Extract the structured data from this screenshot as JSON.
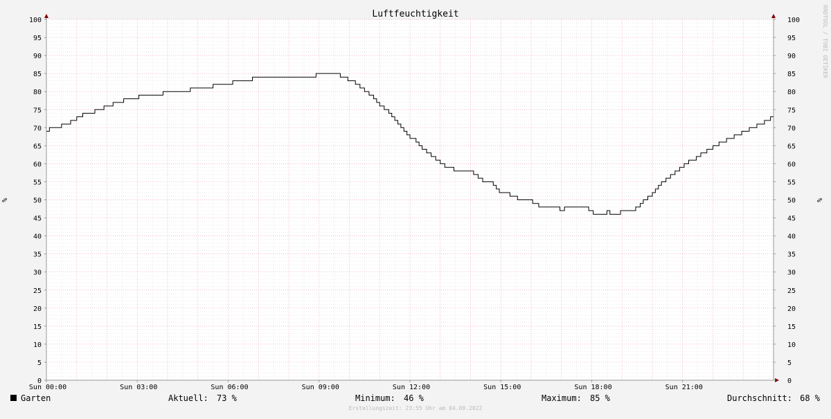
{
  "chart_data": {
    "type": "line",
    "title": "Luftfeuchtigkeit",
    "ylabel": "%",
    "ylim": [
      0,
      100
    ],
    "yticks": [
      0,
      5,
      10,
      15,
      20,
      25,
      30,
      35,
      40,
      45,
      50,
      55,
      60,
      65,
      70,
      75,
      80,
      85,
      90,
      95,
      100
    ],
    "x_range_hours": [
      0,
      24
    ],
    "x_ticks": [
      {
        "hour": 0,
        "label": "Sun 00:00"
      },
      {
        "hour": 3,
        "label": "Sun 03:00"
      },
      {
        "hour": 6,
        "label": "Sun 06:00"
      },
      {
        "hour": 9,
        "label": "Sun 09:00"
      },
      {
        "hour": 12,
        "label": "Sun 12:00"
      },
      {
        "hour": 15,
        "label": "Sun 15:00"
      },
      {
        "hour": 18,
        "label": "Sun 18:00"
      },
      {
        "hour": 21,
        "label": "Sun 21:00"
      }
    ],
    "grid": true,
    "series": [
      {
        "name": "Garten",
        "color": "#000000",
        "points": [
          [
            0.0,
            69
          ],
          [
            0.1,
            70
          ],
          [
            0.5,
            71
          ],
          [
            0.8,
            72
          ],
          [
            1.0,
            73
          ],
          [
            1.2,
            74
          ],
          [
            1.6,
            75
          ],
          [
            1.9,
            76
          ],
          [
            2.2,
            77
          ],
          [
            2.55,
            78
          ],
          [
            3.05,
            79
          ],
          [
            3.85,
            80
          ],
          [
            4.75,
            81
          ],
          [
            5.5,
            82
          ],
          [
            6.15,
            83
          ],
          [
            6.8,
            84
          ],
          [
            8.9,
            85
          ],
          [
            9.7,
            84
          ],
          [
            9.95,
            83
          ],
          [
            10.2,
            82
          ],
          [
            10.35,
            81
          ],
          [
            10.5,
            80
          ],
          [
            10.65,
            79
          ],
          [
            10.8,
            78
          ],
          [
            10.9,
            77
          ],
          [
            11.0,
            76
          ],
          [
            11.15,
            75
          ],
          [
            11.3,
            74
          ],
          [
            11.4,
            73
          ],
          [
            11.5,
            72
          ],
          [
            11.6,
            71
          ],
          [
            11.7,
            70
          ],
          [
            11.8,
            69
          ],
          [
            11.9,
            68
          ],
          [
            12.0,
            67
          ],
          [
            12.2,
            66
          ],
          [
            12.3,
            65
          ],
          [
            12.4,
            64
          ],
          [
            12.55,
            63
          ],
          [
            12.7,
            62
          ],
          [
            12.85,
            61
          ],
          [
            13.0,
            60
          ],
          [
            13.15,
            59
          ],
          [
            13.45,
            58
          ],
          [
            14.1,
            57
          ],
          [
            14.25,
            56
          ],
          [
            14.4,
            55
          ],
          [
            14.75,
            54
          ],
          [
            14.85,
            53
          ],
          [
            14.95,
            52
          ],
          [
            15.3,
            51
          ],
          [
            15.55,
            50
          ],
          [
            16.05,
            49
          ],
          [
            16.25,
            48
          ],
          [
            16.95,
            47
          ],
          [
            17.1,
            48
          ],
          [
            17.9,
            47
          ],
          [
            18.05,
            46
          ],
          [
            18.5,
            47
          ],
          [
            18.6,
            46
          ],
          [
            18.95,
            47
          ],
          [
            19.45,
            48
          ],
          [
            19.6,
            49
          ],
          [
            19.7,
            50
          ],
          [
            19.85,
            51
          ],
          [
            20.0,
            52
          ],
          [
            20.1,
            53
          ],
          [
            20.2,
            54
          ],
          [
            20.3,
            55
          ],
          [
            20.45,
            56
          ],
          [
            20.6,
            57
          ],
          [
            20.75,
            58
          ],
          [
            20.9,
            59
          ],
          [
            21.05,
            60
          ],
          [
            21.2,
            61
          ],
          [
            21.45,
            62
          ],
          [
            21.6,
            63
          ],
          [
            21.8,
            64
          ],
          [
            22.0,
            65
          ],
          [
            22.2,
            66
          ],
          [
            22.45,
            67
          ],
          [
            22.7,
            68
          ],
          [
            22.95,
            69
          ],
          [
            23.2,
            70
          ],
          [
            23.45,
            71
          ],
          [
            23.7,
            72
          ],
          [
            23.9,
            73
          ],
          [
            24.0,
            73
          ]
        ]
      }
    ],
    "legend": {
      "name": "Garten",
      "stats": [
        {
          "label": "Aktuell:",
          "value": "73 %"
        },
        {
          "label": "Minimum:",
          "value": "46 %"
        },
        {
          "label": "Maximum:",
          "value": "85 %"
        },
        {
          "label": "Durchschnitt:",
          "value": "68 %"
        }
      ]
    },
    "watermark": "RRDTOOL / TOBI OETIKER",
    "footer": "Erstellungszeit: 23:55 Uhr am 04.09.2022",
    "colors": {
      "background": "#f3f3f3",
      "canvas": "#ffffff",
      "grid_minor": "#dddddd",
      "grid_major": "#e8a0b0",
      "axis": "#999999",
      "arrow": "#800000",
      "line": "#000000",
      "text": "#000000",
      "footer": "#bbbbbb"
    }
  }
}
